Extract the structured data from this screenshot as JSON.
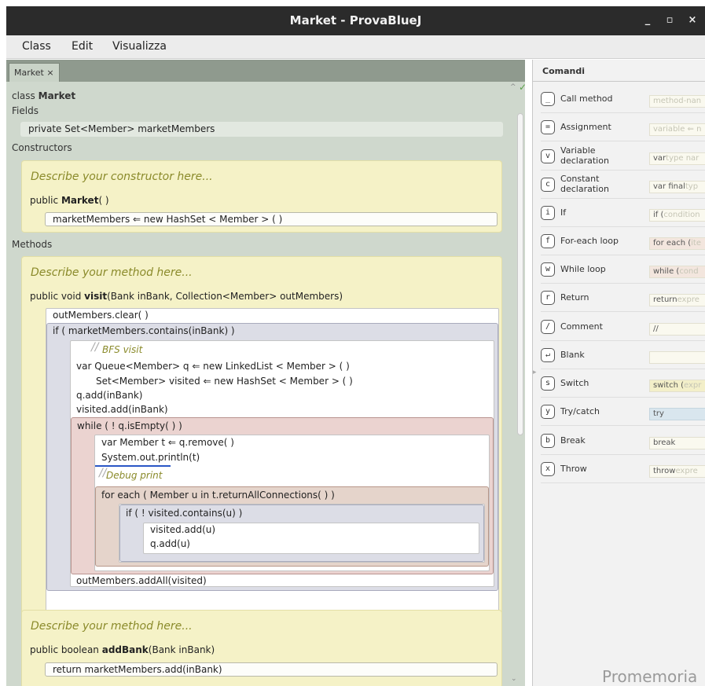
{
  "window": {
    "title": "Market - ProvaBlueJ",
    "minimize": "_",
    "maximize": "▫",
    "close": "×"
  },
  "menu": [
    "Class",
    "Edit",
    "Visualizza"
  ],
  "tab": {
    "label": "Market",
    "close": "×"
  },
  "editor": {
    "class_kw": "class",
    "class_name": "Market",
    "fields_header": "Fields",
    "field_line": "private Set<Member> marketMembers",
    "constructors_header": "Constructors",
    "constructor": {
      "comment": "Describe your constructor here...",
      "sig_prefix": "public",
      "sig_name": "Market",
      "sig_suffix": "( )",
      "body": "marketMembers ⇐  new  HashSet < Member > ( )"
    },
    "methods_header": "Methods",
    "visit": {
      "comment": "Describe your method here...",
      "sig_prefix": "public void",
      "sig_name": "visit",
      "sig_suffix": "(Bank inBank, Collection<Member> outMembers)",
      "line1": "outMembers.clear( )",
      "if_header": "if ( marketMembers.contains(inBank) )",
      "bfs_comment": "BFS visit",
      "var_q": "var Queue<Member> q ⇐  new  LinkedList < Member > ( )",
      "set_visited": "Set<Member> visited ⇐  new  HashSet < Member > ( )",
      "q_add": "q.add(inBank)",
      "visited_add": "visited.add(inBank)",
      "while_header": "while (  ! q.isEmpty( ) )",
      "var_t": "var Member t ⇐ q.remove( )",
      "println": "System.out.println(t)",
      "debug_comment": "Debug print",
      "foreach_header": "for each (  Member u  in  t.returnAllConnections( ) )",
      "inner_if": "if (  ! visited.contains(u) )",
      "visited_add_u": "visited.add(u)",
      "q_add_u": "q.add(u)",
      "addall": "outMembers.addAll(visited)"
    },
    "addbank": {
      "comment": "Describe your method here...",
      "sig_prefix": "public boolean",
      "sig_name": "addBank",
      "sig_suffix": "(Bank inBank)",
      "body": "return marketMembers.add(inBank)"
    }
  },
  "commands": {
    "title": "Comandi",
    "items": [
      {
        "key": "_",
        "label": "Call method",
        "preview": "method-nan",
        "preview_kw": ""
      },
      {
        "key": "=",
        "label": "Assignment",
        "preview": "variable ⇐ n",
        "preview_kw": ""
      },
      {
        "key": "v",
        "label": "Variable declaration",
        "preview_kw": "var",
        "preview": "type nar"
      },
      {
        "key": "c",
        "label": "Constant declaration",
        "preview_kw": "var final",
        "preview": "typ"
      },
      {
        "key": "i",
        "label": "If",
        "preview_kw": "if (",
        "preview": "condition"
      },
      {
        "key": "f",
        "label": "For-each loop",
        "preview_kw": "for each (",
        "preview": "ite"
      },
      {
        "key": "w",
        "label": "While loop",
        "preview_kw": "while (",
        "preview": "cond"
      },
      {
        "key": "r",
        "label": "Return",
        "preview_kw": "return",
        "preview": "expre"
      },
      {
        "key": "/",
        "label": "Comment",
        "preview_kw": "//",
        "preview": ""
      },
      {
        "key": "↵",
        "label": "Blank",
        "preview_kw": "",
        "preview": ""
      },
      {
        "key": "s",
        "label": "Switch",
        "preview_kw": "switch (",
        "preview": "expr"
      },
      {
        "key": "y",
        "label": "Try/catch",
        "preview_kw": "try",
        "preview": ""
      },
      {
        "key": "b",
        "label": "Break",
        "preview_kw": "break",
        "preview": ""
      },
      {
        "key": "x",
        "label": "Throw",
        "preview_kw": "throw",
        "preview": "expre"
      }
    ],
    "footer": "Promemoria"
  }
}
